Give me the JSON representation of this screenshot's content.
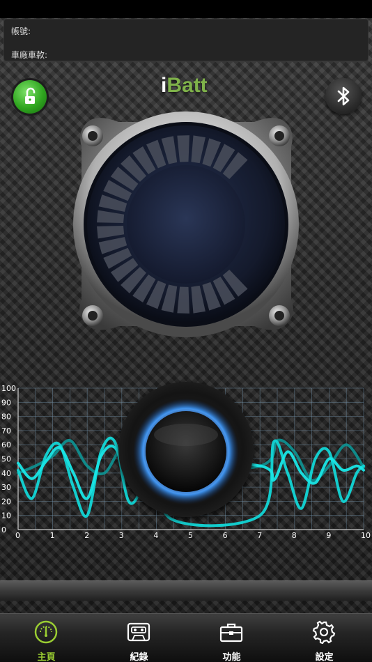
{
  "info": {
    "account_label": "帳號:",
    "account_value": "",
    "vehicle_label": "車廠車款:",
    "vehicle_value": ""
  },
  "brand": {
    "prefix": "i",
    "name": "Batt"
  },
  "icons": {
    "lock": "unlock-icon",
    "bluetooth": "bluetooth-icon"
  },
  "gauge": {
    "segments_lit": 0,
    "segments_total": 26
  },
  "chart_data": {
    "type": "line",
    "title": "",
    "xlabel": "",
    "ylabel": "",
    "xlim": [
      0,
      10
    ],
    "ylim": [
      0,
      100
    ],
    "x_ticks": [
      "0",
      "1",
      "2",
      "3",
      "4",
      "5",
      "6",
      "7",
      "8",
      "9",
      "10"
    ],
    "y_ticks": [
      "0",
      "10",
      "20",
      "30",
      "40",
      "50",
      "60",
      "70",
      "80",
      "90",
      "100"
    ],
    "grid": true,
    "series": [
      {
        "color": "#19e6e6",
        "x": [
          0,
          0.4,
          0.8,
          1.2,
          1.6,
          2.0,
          2.4,
          2.8,
          3.2,
          3.6,
          4.0,
          7.0,
          7.4,
          7.8,
          8.2,
          8.6,
          9.0,
          9.4,
          9.8,
          10
        ],
        "values": [
          47,
          36,
          48,
          58,
          40,
          22,
          52,
          58,
          35,
          35,
          50,
          45,
          35,
          55,
          40,
          33,
          50,
          42,
          45,
          42
        ]
      },
      {
        "color": "#12d6d6",
        "x": [
          0,
          0.4,
          0.8,
          1.2,
          1.6,
          2.0,
          2.4,
          2.8,
          3.2,
          3.6,
          4.0,
          4.4,
          7.0,
          7.4,
          7.8,
          8.2,
          8.6,
          9.0,
          9.4,
          9.8,
          10
        ],
        "values": [
          42,
          22,
          52,
          60,
          30,
          10,
          55,
          62,
          20,
          30,
          55,
          8,
          10,
          62,
          40,
          15,
          50,
          55,
          20,
          40,
          45
        ]
      },
      {
        "color": "#0f8f8f",
        "x": [
          0,
          0.5,
          1.0,
          1.5,
          2.0,
          2.5,
          3.0,
          3.5,
          4.0,
          7.0,
          7.5,
          8.0,
          8.5,
          9.0,
          9.5,
          10
        ],
        "values": [
          40,
          45,
          52,
          63,
          45,
          40,
          57,
          48,
          40,
          45,
          63,
          55,
          35,
          45,
          60,
          44
        ]
      }
    ]
  },
  "tabs": [
    {
      "label": "主頁",
      "icon": "speedometer-icon",
      "active": true
    },
    {
      "label": "紀錄",
      "icon": "cassette-icon",
      "active": false
    },
    {
      "label": "功能",
      "icon": "toolbox-icon",
      "active": false
    },
    {
      "label": "設定",
      "icon": "gear-icon",
      "active": false
    }
  ],
  "colors": {
    "accent": "#9acd32",
    "wave": "#19e6e6",
    "lock": "#2fa51f"
  }
}
